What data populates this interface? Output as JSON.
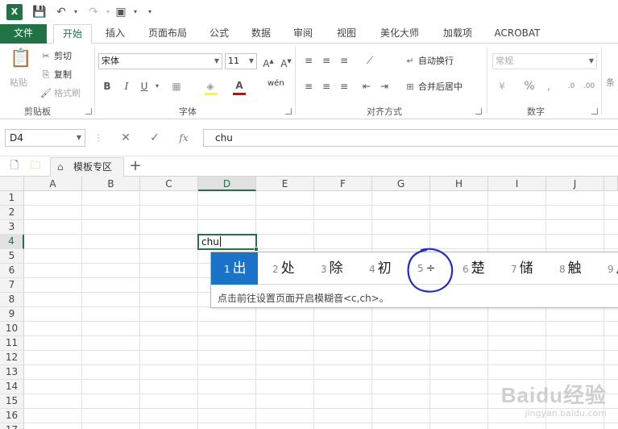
{
  "app": {
    "logo_letter": "X"
  },
  "tabs": [
    {
      "label": "文件"
    },
    {
      "label": "开始"
    },
    {
      "label": "插入"
    },
    {
      "label": "页面布局"
    },
    {
      "label": "公式"
    },
    {
      "label": "数据"
    },
    {
      "label": "审阅"
    },
    {
      "label": "视图"
    },
    {
      "label": "美化大师"
    },
    {
      "label": "加载项"
    },
    {
      "label": "ACROBAT"
    }
  ],
  "ribbon": {
    "clipboard": {
      "label": "剪贴板",
      "paste": "粘贴",
      "cut": "剪切",
      "copy": "复制",
      "format_painter": "格式刷"
    },
    "font": {
      "label": "字体",
      "name": "宋体",
      "size": "11",
      "bold": "B",
      "italic": "I",
      "underline": "U",
      "phonetic": "wén"
    },
    "alignment": {
      "label": "对齐方式",
      "wrap": "自动换行",
      "merge": "合并后居中"
    },
    "number": {
      "label": "数字",
      "format": "常规",
      "percent": "%",
      "comma": ","
    },
    "styles": {
      "partial_label": "条"
    }
  },
  "formula_bar": {
    "name_box": "D4",
    "fx": "fx",
    "value": "chu"
  },
  "template_bar": {
    "tab_label": "模板专区"
  },
  "sheet": {
    "columns": [
      "A",
      "B",
      "C",
      "D",
      "E",
      "F",
      "G",
      "H",
      "I",
      "J"
    ],
    "rows": [
      "1",
      "2",
      "3",
      "4",
      "5",
      "6",
      "7",
      "8",
      "9",
      "10",
      "11",
      "12",
      "13",
      "14",
      "15",
      "16",
      "17"
    ],
    "selected_column": "D",
    "selected_row": "4",
    "active_cell_text": "chu"
  },
  "ime": {
    "candidates": [
      {
        "n": "1",
        "text": "出"
      },
      {
        "n": "2",
        "text": "处"
      },
      {
        "n": "3",
        "text": "除"
      },
      {
        "n": "4",
        "text": "初"
      },
      {
        "n": "5",
        "text": "÷"
      },
      {
        "n": "6",
        "text": "楚"
      },
      {
        "n": "7",
        "text": "储"
      },
      {
        "n": "8",
        "text": "触"
      },
      {
        "n": "9",
        "text": "川"
      }
    ],
    "hint": "点击前往设置页面开启模糊音<c,ch>。",
    "selected_color": "#1a73c8",
    "annotation_color": "#1f2bd1"
  },
  "watermark": {
    "title": "Baidu经验",
    "url": "jingyan.baidu.com"
  },
  "colors": {
    "accent": "#217346"
  }
}
